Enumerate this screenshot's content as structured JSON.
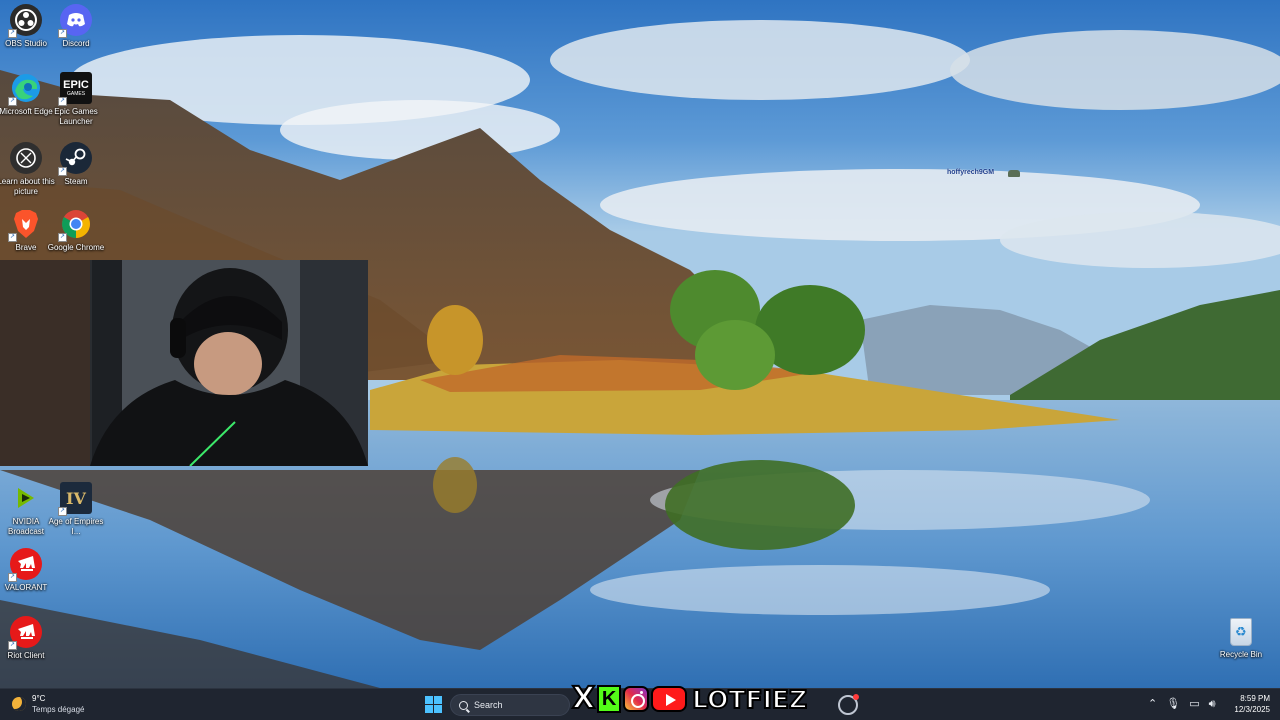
{
  "desktop": {
    "icons": [
      {
        "name": "obs-studio",
        "label": "OBS Studio",
        "icon": "obs-icon",
        "color": "#2b2b2b"
      },
      {
        "name": "discord",
        "label": "Discord",
        "icon": "discord-icon",
        "color": "#5865f2"
      },
      {
        "name": "microsoft-edge",
        "label": "Microsoft Edge",
        "icon": "edge-icon",
        "color": "#1c9be7"
      },
      {
        "name": "epic-games",
        "label": "Epic Games Launcher",
        "icon": "epic-games-icon",
        "color": "#111111"
      },
      {
        "name": "learn-about-picture",
        "label": "Learn about this picture",
        "icon": "learn-picture-icon",
        "color": "#2f2f2f"
      },
      {
        "name": "steam",
        "label": "Steam",
        "icon": "steam-icon",
        "color": "#1b2838"
      },
      {
        "name": "brave",
        "label": "Brave",
        "icon": "brave-icon",
        "color": "#fb542b"
      },
      {
        "name": "google-chrome",
        "label": "Google Chrome",
        "icon": "chrome-icon",
        "color": "#4285f4"
      },
      {
        "name": "nvidia-broadcast",
        "label": "NVIDIA Broadcast",
        "icon": "nvidia-icon",
        "color": "#76b900"
      },
      {
        "name": "age-of-empires",
        "label": "Age of Empires I...",
        "icon": "age-of-empires-icon",
        "color": "#1c2a3c"
      },
      {
        "name": "valorant",
        "label": "VALORANT",
        "icon": "riot-icon",
        "color": "#e61919"
      },
      {
        "name": "riot-client",
        "label": "Riot Client",
        "icon": "riot-icon",
        "color": "#e61919"
      }
    ],
    "recycle_bin": {
      "label": "Recycle Bin",
      "icon": "recycle-bin-icon"
    },
    "username_overlay": "hoffyrech9GM"
  },
  "taskbar": {
    "weather": {
      "temp": "9°C",
      "condition": "Temps dégagé",
      "icon": "moon-icon"
    },
    "search_placeholder": "Search",
    "brand": {
      "x": "X",
      "k": "K",
      "name": "LOTFIEZ"
    },
    "clock": {
      "time": "8:59 PM",
      "date": "12/3/2025"
    },
    "tray_icons": [
      "chevron-up-icon",
      "microphone-icon",
      "display-icon",
      "speaker-icon"
    ]
  },
  "colors": {
    "taskbar_bg": "#1f2530",
    "start_accent": "#4cc2ff",
    "kick_green": "#53fc18",
    "youtube_red": "#ff1a1a"
  }
}
